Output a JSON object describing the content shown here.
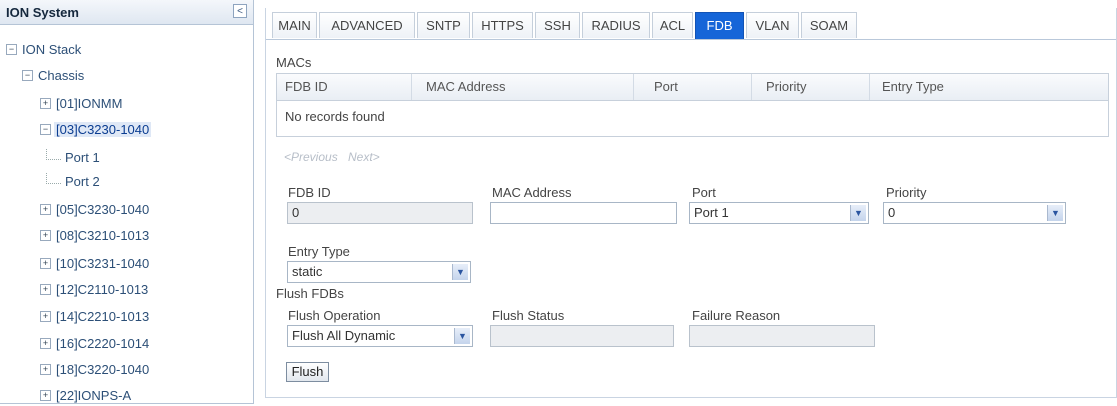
{
  "tree": {
    "title": "ION System",
    "collapse_glyph": "<",
    "nodes": [
      {
        "label": "ION Stack",
        "expander": "−"
      },
      {
        "label": "Chassis",
        "expander": "−"
      },
      {
        "label": "[01]IONMM",
        "expander": "+"
      },
      {
        "label": "[03]C3230-1040",
        "expander": "−"
      },
      {
        "label": "Port 1"
      },
      {
        "label": "Port 2"
      },
      {
        "label": "[05]C3230-1040",
        "expander": "+"
      },
      {
        "label": "[08]C3210-1013",
        "expander": "+"
      },
      {
        "label": "[10]C3231-1040",
        "expander": "+"
      },
      {
        "label": "[12]C2110-1013",
        "expander": "+"
      },
      {
        "label": "[14]C2210-1013",
        "expander": "+"
      },
      {
        "label": "[16]C2220-1014",
        "expander": "+"
      },
      {
        "label": "[18]C3220-1040",
        "expander": "+"
      },
      {
        "label": "[22]IONPS-A",
        "expander": "+"
      }
    ]
  },
  "tabs": [
    "MAIN",
    "ADVANCED",
    "SNTP",
    "HTTPS",
    "SSH",
    "RADIUS",
    "ACL",
    "FDB",
    "VLAN",
    "SOAM"
  ],
  "active_tab": "FDB",
  "macs": {
    "section_title": "MACs",
    "columns": [
      "FDB ID",
      "MAC Address",
      "Port",
      "Priority",
      "Entry Type"
    ],
    "empty_text": "No records found",
    "pager": {
      "previous": "<Previous",
      "next": "Next>"
    }
  },
  "form": {
    "fdb_id": {
      "label": "FDB ID",
      "value": "0"
    },
    "mac_address": {
      "label": "MAC Address",
      "value": ""
    },
    "port": {
      "label": "Port",
      "value": "Port 1"
    },
    "priority": {
      "label": "Priority",
      "value": "0"
    },
    "entry_type": {
      "label": "Entry Type",
      "value": "static"
    }
  },
  "flush": {
    "section_title": "Flush FDBs",
    "operation": {
      "label": "Flush Operation",
      "value": "Flush All Dynamic"
    },
    "status": {
      "label": "Flush Status",
      "value": ""
    },
    "failure_reason": {
      "label": "Failure Reason",
      "value": ""
    },
    "button_label": "Flush"
  }
}
